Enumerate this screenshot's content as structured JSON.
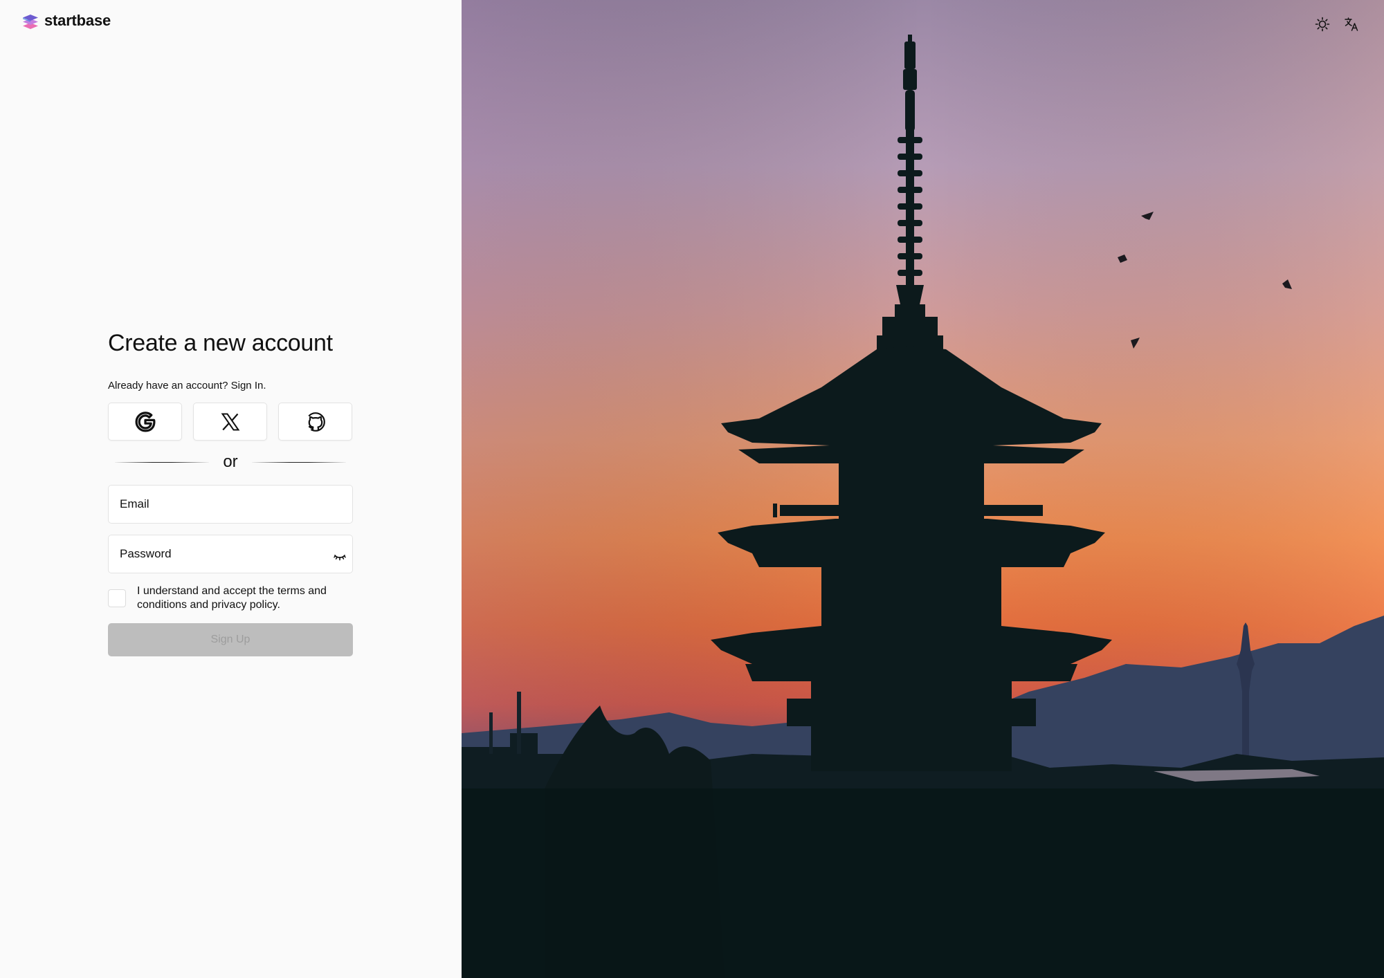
{
  "brand": {
    "name": "startbase",
    "logo_icon": "layers-icon",
    "colors": {
      "layer_top": "#6d5bd0",
      "layer_mid": "#c37ee0",
      "layer_bottom": "#ea6db3"
    }
  },
  "form": {
    "title": "Create a new account",
    "subtitle_prefix": "Already have an account?",
    "signin_link": "Sign In.",
    "oauth": [
      {
        "provider": "Google",
        "icon": "google-icon"
      },
      {
        "provider": "X",
        "icon": "x-icon"
      },
      {
        "provider": "GitHub",
        "icon": "github-icon"
      }
    ],
    "divider_text": "or",
    "email_placeholder": "Email",
    "password_placeholder": "Password",
    "password_toggle_icon": "eye-closed-icon",
    "terms_text": "I understand and accept the terms and conditions and privacy policy.",
    "terms_checked": false,
    "submit_label": "Sign Up",
    "submit_disabled": true
  },
  "header_actions": {
    "theme_toggle_icon": "sun-icon",
    "language_icon": "translate-icon"
  },
  "hero_image": {
    "subject": "pagoda-silhouette-sunset",
    "sky_colors": [
      "#9c88a8",
      "#d9a090",
      "#ee8d55",
      "#df6a3c"
    ]
  }
}
